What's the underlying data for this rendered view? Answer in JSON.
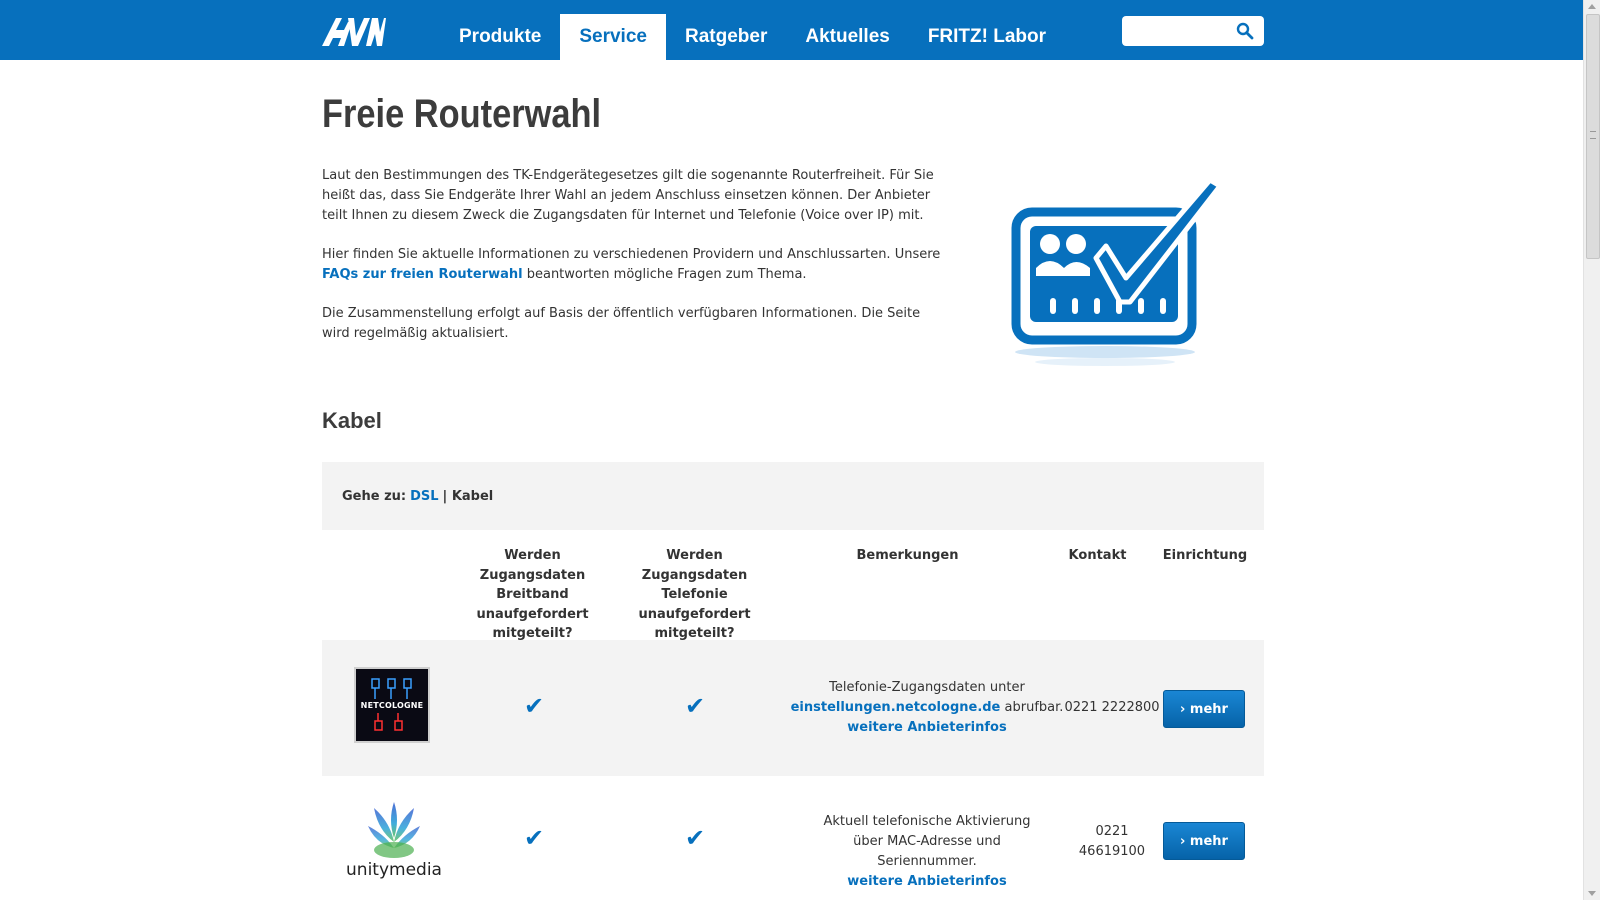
{
  "header": {
    "nav": [
      {
        "label": "Produkte",
        "active": false
      },
      {
        "label": "Service",
        "active": true
      },
      {
        "label": "Ratgeber",
        "active": false
      },
      {
        "label": "Aktuelles",
        "active": false
      },
      {
        "label": "FRITZ! Labor",
        "active": false
      }
    ],
    "search": {
      "value": "",
      "placeholder": ""
    },
    "colors": {
      "brand": "#0770bd"
    }
  },
  "page": {
    "title": "Freie Routerwahl",
    "intro": {
      "p1": "Laut den Bestimmungen des TK-Endgerätegesetzes gilt die sogenannte Routerfreiheit. Für Sie heißt das, dass Sie Endgeräte Ihrer Wahl an jedem Anschluss einsetzen können. Der Anbieter teilt Ihnen zu diesem Zweck die Zugangsdaten für Internet und Telefonie (Voice over IP) mit.",
      "p2_before": "Hier finden Sie aktuelle Informationen zu verschiedenen Providern und Anschlussarten. Unsere ",
      "p2_link": "FAQs zur freien Routerwahl",
      "p2_after": " beantworten mögliche Fragen zum Thema.",
      "p3": "Die Zusammenstellung erfolgt auf Basis der öffentlich verfügbaren Informationen. Die Seite wird regelmäßig aktualisiert."
    }
  },
  "section": {
    "title": "Kabel",
    "goto": {
      "label": "Gehe zu:",
      "link_dsl": "DSL",
      "separator": "|",
      "current": "Kabel"
    }
  },
  "table": {
    "headers": {
      "breitband": "Werden Zugangsdaten Breitband unaufgefordert mitgeteilt?",
      "telefonie": "Werden Zugangsdaten Telefonie unaufgefordert mitgeteilt?",
      "bemerkungen": "Bemerkungen",
      "kontakt": "Kontakt",
      "einrichtung": "Einrichtung"
    },
    "check_glyph": "✔",
    "rows": [
      {
        "logo_text": "NETCOLOGNE",
        "remark_before": "Telefonie-Zugangsdaten unter",
        "remark_link": "einstellungen.netcologne.de",
        "remark_after": " abrufbar.",
        "more_link": "weitere Anbieterinfos",
        "contact": "0221 2222800",
        "button": "› mehr"
      },
      {
        "logo_text": "unitymedia",
        "remark_text": "Aktuell telefonische Aktivierung über MAC-Adresse und Seriennummer.",
        "more_link": "weitere Anbieterinfos",
        "contact_1": "0221",
        "contact_2": "46619100",
        "button": "› mehr"
      }
    ]
  }
}
